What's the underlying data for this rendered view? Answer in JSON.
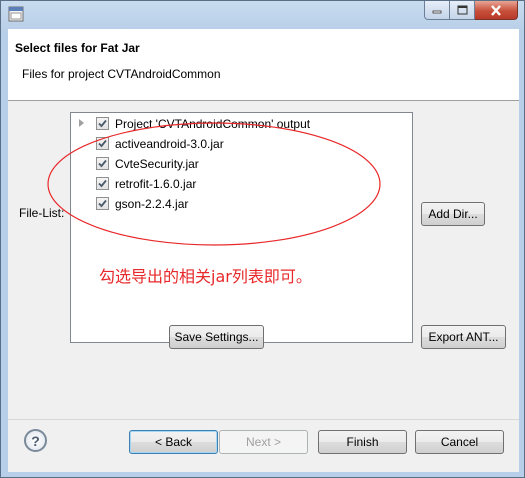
{
  "window": {
    "buttons": [
      "minimize",
      "maximize",
      "close"
    ]
  },
  "header": {
    "title": "Select files for Fat Jar",
    "description": "Files for project CVTAndroidCommon"
  },
  "file_list": {
    "label": "File-List:",
    "items": [
      {
        "label": "Project 'CVTAndroidCommon' output",
        "checked": true,
        "expandable": true
      },
      {
        "label": "activeandroid-3.0.jar",
        "checked": true
      },
      {
        "label": "CvteSecurity.jar",
        "checked": true
      },
      {
        "label": "retrofit-1.6.0.jar",
        "checked": true
      },
      {
        "label": "gson-2.2.4.jar",
        "checked": true
      }
    ]
  },
  "annotation": {
    "text": "勾选导出的相关jar列表即可。",
    "color": "#e8282a"
  },
  "buttons": {
    "add_dir": "Add Dir...",
    "save_settings": "Save Settings...",
    "export_ant": "Export ANT...",
    "back": "< Back",
    "next": "Next >",
    "finish": "Finish",
    "cancel": "Cancel"
  },
  "help": {
    "glyph": "?"
  }
}
